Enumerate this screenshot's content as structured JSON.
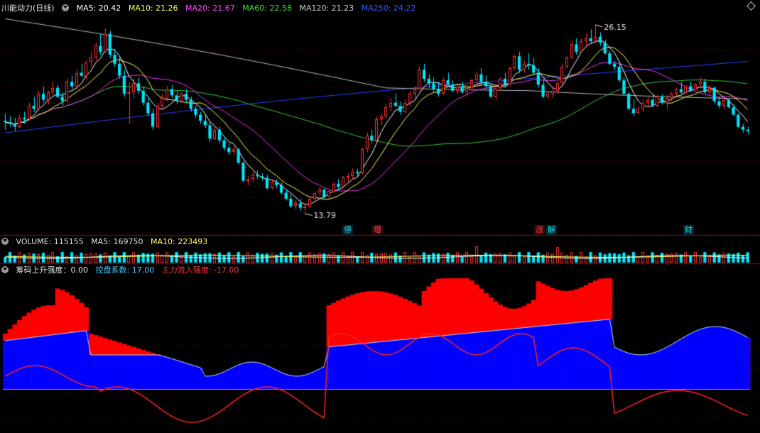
{
  "header": {
    "title": "川能动力(日线)",
    "ma": [
      {
        "label": "MA5: 20.42",
        "color": "#ffffff"
      },
      {
        "label": "MA10: 21.26",
        "color": "#ffff66"
      },
      {
        "label": "MA20: 21.67",
        "color": "#ff44ff"
      },
      {
        "label": "MA60: 22.58",
        "color": "#44dd44"
      },
      {
        "label": "MA120: 21.23",
        "color": "#cccccc"
      },
      {
        "label": "MA250: 24.22",
        "color": "#3355ff"
      }
    ]
  },
  "volume_header": {
    "title": "VOLUME: 115155",
    "ma5": "MA5: 169750",
    "ma10": "MA10: 223493"
  },
  "indicator_header": {
    "title": "筹码上升强度：0.00",
    "ctrl": "控盘系数: 17.00",
    "main": "主力流入强度: -17.00"
  },
  "tags": [
    {
      "text": "停",
      "color": "#00e5e5",
      "bg": "#0a2030"
    },
    {
      "text": "增",
      "color": "#ff4444",
      "bg": "#2a0a0a"
    },
    {
      "text": "涨",
      "color": "#ff4444",
      "bg": "#2a0a0a"
    },
    {
      "text": "解",
      "color": "#00e5e5",
      "bg": "#0a2030"
    },
    {
      "text": "财",
      "color": "#00e5e5",
      "bg": "#0a2030"
    }
  ],
  "colors": {
    "up": "#ff3333",
    "down": "#00e5ff",
    "grid": "#6a0000",
    "red_fill": "#ff0000",
    "blue_fill": "#0000ff"
  },
  "chart_data": {
    "type": "candlestick",
    "price_range": [
      13,
      27.2
    ],
    "annotations": {
      "high": "26.15",
      "low": "13.79"
    },
    "ohlc": [
      [
        20.0,
        20.5,
        19.4,
        19.9
      ],
      [
        19.9,
        20.3,
        19.6,
        19.8
      ],
      [
        19.8,
        20.2,
        19.3,
        19.6
      ],
      [
        19.6,
        20.4,
        19.5,
        20.2
      ],
      [
        20.2,
        20.6,
        19.8,
        20.1
      ],
      [
        20.1,
        21.2,
        20.0,
        21.0
      ],
      [
        21.0,
        21.6,
        20.6,
        20.8
      ],
      [
        20.8,
        22.0,
        20.7,
        21.8
      ],
      [
        21.8,
        22.3,
        21.2,
        21.4
      ],
      [
        21.4,
        22.0,
        21.1,
        21.9
      ],
      [
        21.9,
        22.6,
        21.7,
        22.2
      ],
      [
        22.2,
        22.4,
        21.5,
        21.6
      ],
      [
        21.6,
        21.9,
        21.0,
        21.3
      ],
      [
        21.3,
        22.8,
        21.2,
        22.6
      ],
      [
        22.6,
        23.0,
        22.1,
        22.3
      ],
      [
        22.3,
        23.4,
        22.1,
        23.2
      ],
      [
        23.2,
        23.8,
        22.9,
        23.0
      ],
      [
        23.0,
        24.0,
        22.8,
        23.9
      ],
      [
        23.9,
        24.6,
        23.6,
        24.2
      ],
      [
        24.2,
        25.2,
        24.0,
        25.0
      ],
      [
        25.0,
        25.8,
        24.4,
        24.6
      ],
      [
        24.6,
        26.15,
        24.5,
        25.8
      ],
      [
        25.8,
        26.0,
        24.2,
        24.4
      ],
      [
        24.4,
        24.8,
        23.6,
        23.8
      ],
      [
        23.8,
        24.2,
        22.8,
        23.0
      ],
      [
        23.0,
        23.4,
        21.6,
        21.8
      ],
      [
        21.8,
        22.6,
        19.8,
        21.9
      ],
      [
        21.9,
        22.8,
        21.5,
        22.5
      ],
      [
        22.5,
        22.9,
        21.8,
        22.0
      ],
      [
        22.0,
        22.3,
        21.0,
        21.2
      ],
      [
        21.2,
        21.5,
        20.3,
        20.5
      ],
      [
        20.5,
        20.8,
        19.4,
        19.6
      ],
      [
        19.6,
        21.2,
        19.5,
        21.0
      ],
      [
        21.0,
        21.8,
        20.8,
        21.5
      ],
      [
        21.5,
        22.3,
        21.3,
        22.1
      ],
      [
        22.1,
        22.4,
        21.5,
        21.7
      ],
      [
        21.7,
        22.0,
        21.1,
        21.3
      ],
      [
        21.3,
        21.9,
        21.2,
        21.8
      ],
      [
        21.8,
        22.1,
        21.2,
        21.4
      ],
      [
        21.4,
        21.6,
        20.6,
        20.8
      ],
      [
        20.8,
        21.0,
        20.2,
        20.4
      ],
      [
        20.4,
        20.6,
        19.8,
        20.0
      ],
      [
        20.0,
        20.4,
        19.5,
        19.7
      ],
      [
        19.7,
        19.9,
        18.6,
        18.8
      ],
      [
        18.8,
        19.6,
        18.7,
        19.4
      ],
      [
        19.4,
        19.6,
        18.5,
        18.7
      ],
      [
        18.7,
        18.9,
        18.0,
        18.2
      ],
      [
        18.2,
        18.5,
        17.7,
        17.9
      ],
      [
        17.9,
        18.3,
        17.7,
        18.1
      ],
      [
        18.1,
        18.2,
        17.1,
        17.2
      ],
      [
        17.2,
        17.3,
        15.9,
        16.0
      ],
      [
        16.0,
        16.3,
        15.7,
        16.1
      ],
      [
        16.1,
        16.6,
        15.9,
        16.4
      ],
      [
        16.4,
        16.7,
        16.1,
        16.3
      ],
      [
        16.3,
        16.5,
        16.0,
        16.2
      ],
      [
        16.2,
        16.4,
        15.4,
        15.5
      ],
      [
        15.5,
        16.1,
        15.4,
        15.9
      ],
      [
        15.9,
        16.1,
        15.5,
        15.7
      ],
      [
        15.7,
        15.9,
        15.1,
        15.2
      ],
      [
        15.2,
        15.4,
        14.7,
        14.8
      ],
      [
        14.8,
        15.1,
        14.2,
        14.3
      ],
      [
        14.3,
        14.7,
        14.1,
        14.5
      ],
      [
        14.5,
        14.8,
        14.0,
        14.2
      ],
      [
        14.2,
        14.5,
        13.79,
        14.3
      ],
      [
        14.3,
        14.9,
        14.2,
        14.8
      ],
      [
        14.8,
        15.3,
        14.7,
        15.2
      ],
      [
        15.2,
        15.6,
        15.0,
        15.4
      ],
      [
        15.4,
        15.5,
        14.8,
        14.9
      ],
      [
        14.9,
        15.4,
        14.8,
        15.3
      ],
      [
        15.3,
        15.9,
        15.2,
        15.8
      ],
      [
        15.8,
        16.1,
        15.4,
        15.6
      ],
      [
        15.6,
        16.3,
        15.5,
        16.2
      ],
      [
        16.2,
        16.5,
        15.9,
        16.3
      ],
      [
        16.3,
        16.8,
        16.1,
        16.6
      ],
      [
        16.6,
        16.8,
        16.3,
        16.5
      ],
      [
        16.5,
        18.2,
        16.4,
        18.1
      ],
      [
        18.1,
        19.2,
        17.9,
        19.0
      ],
      [
        19.0,
        19.4,
        18.5,
        18.7
      ],
      [
        18.7,
        20.3,
        18.6,
        20.1
      ],
      [
        20.1,
        20.5,
        19.7,
        20.3
      ],
      [
        20.3,
        21.1,
        20.1,
        20.9
      ],
      [
        20.9,
        21.5,
        20.6,
        21.2
      ],
      [
        21.2,
        21.8,
        20.9,
        21.0
      ],
      [
        21.0,
        21.3,
        20.4,
        20.6
      ],
      [
        20.6,
        21.4,
        20.5,
        21.2
      ],
      [
        21.2,
        22.0,
        21.0,
        21.8
      ],
      [
        21.8,
        22.3,
        21.5,
        22.1
      ],
      [
        22.1,
        23.6,
        22.0,
        23.4
      ],
      [
        23.4,
        23.8,
        22.6,
        22.8
      ],
      [
        22.8,
        23.1,
        22.2,
        22.5
      ],
      [
        22.5,
        22.9,
        21.9,
        22.1
      ],
      [
        22.1,
        22.6,
        21.6,
        21.8
      ],
      [
        21.8,
        22.9,
        21.7,
        22.7
      ],
      [
        22.7,
        23.2,
        22.3,
        22.4
      ],
      [
        22.4,
        22.7,
        21.9,
        22.0
      ],
      [
        22.0,
        22.5,
        21.8,
        22.3
      ],
      [
        22.3,
        22.6,
        21.8,
        21.9
      ],
      [
        21.9,
        22.4,
        21.6,
        22.2
      ],
      [
        22.2,
        22.8,
        22.0,
        22.7
      ],
      [
        22.7,
        23.3,
        22.5,
        23.1
      ],
      [
        23.1,
        23.5,
        22.4,
        22.6
      ],
      [
        22.6,
        23.0,
        22.1,
        22.3
      ],
      [
        22.3,
        22.5,
        21.5,
        21.6
      ],
      [
        21.6,
        22.4,
        21.4,
        22.2
      ],
      [
        22.2,
        22.9,
        22.0,
        22.8
      ],
      [
        22.8,
        23.2,
        22.2,
        22.4
      ],
      [
        22.4,
        23.6,
        22.3,
        23.5
      ],
      [
        23.5,
        24.4,
        23.4,
        24.3
      ],
      [
        24.3,
        24.6,
        23.2,
        23.4
      ],
      [
        23.4,
        24.0,
        23.2,
        23.8
      ],
      [
        23.8,
        24.5,
        23.4,
        23.7
      ],
      [
        23.7,
        24.2,
        23.0,
        23.2
      ],
      [
        23.2,
        23.5,
        22.2,
        22.4
      ],
      [
        22.4,
        22.8,
        21.5,
        21.6
      ],
      [
        21.6,
        22.0,
        21.4,
        21.8
      ],
      [
        21.8,
        22.3,
        21.5,
        22.0
      ],
      [
        22.0,
        22.6,
        21.8,
        22.5
      ],
      [
        22.5,
        23.8,
        22.4,
        23.6
      ],
      [
        23.6,
        24.3,
        23.5,
        24.2
      ],
      [
        24.2,
        25.3,
        24.1,
        25.1
      ],
      [
        25.1,
        25.5,
        24.4,
        24.6
      ],
      [
        24.6,
        25.5,
        24.5,
        25.3
      ],
      [
        25.3,
        25.8,
        24.9,
        25.5
      ],
      [
        25.5,
        26.1,
        25.1,
        25.3
      ],
      [
        25.3,
        26.4,
        25.2,
        25.6
      ],
      [
        25.6,
        25.9,
        25.0,
        25.2
      ],
      [
        25.2,
        25.4,
        24.4,
        24.5
      ],
      [
        24.5,
        24.7,
        23.7,
        23.8
      ],
      [
        23.8,
        24.0,
        23.4,
        23.6
      ],
      [
        23.6,
        23.8,
        22.6,
        22.7
      ],
      [
        22.7,
        22.9,
        21.7,
        21.8
      ],
      [
        21.8,
        21.9,
        20.7,
        20.8
      ],
      [
        20.8,
        21.4,
        20.3,
        20.5
      ],
      [
        20.5,
        21.0,
        20.4,
        20.8
      ],
      [
        20.8,
        21.4,
        20.6,
        21.2
      ],
      [
        21.2,
        21.6,
        20.9,
        21.4
      ],
      [
        21.4,
        21.8,
        20.9,
        21.0
      ],
      [
        21.0,
        21.7,
        20.9,
        21.6
      ],
      [
        21.6,
        21.8,
        21.1,
        21.2
      ],
      [
        21.2,
        21.7,
        20.8,
        21.5
      ],
      [
        21.5,
        21.9,
        21.3,
        21.8
      ],
      [
        21.8,
        22.2,
        21.6,
        22.1
      ],
      [
        22.1,
        22.6,
        21.8,
        21.9
      ],
      [
        21.9,
        22.4,
        21.8,
        22.3
      ],
      [
        22.3,
        22.6,
        21.9,
        22.0
      ],
      [
        22.0,
        22.5,
        21.9,
        22.4
      ],
      [
        22.4,
        22.9,
        22.2,
        22.6
      ],
      [
        22.6,
        22.8,
        21.8,
        21.9
      ],
      [
        21.9,
        22.4,
        21.7,
        22.2
      ],
      [
        22.2,
        22.3,
        21.1,
        21.3
      ],
      [
        21.3,
        21.6,
        20.8,
        21.0
      ],
      [
        21.0,
        21.5,
        20.8,
        21.4
      ],
      [
        21.4,
        21.5,
        20.8,
        20.9
      ],
      [
        20.9,
        21.1,
        20.3,
        20.4
      ],
      [
        20.4,
        20.5,
        19.5,
        19.6
      ],
      [
        19.6,
        19.8,
        19.2,
        19.4
      ],
      [
        19.4,
        19.6,
        19.1,
        19.3
      ]
    ]
  }
}
